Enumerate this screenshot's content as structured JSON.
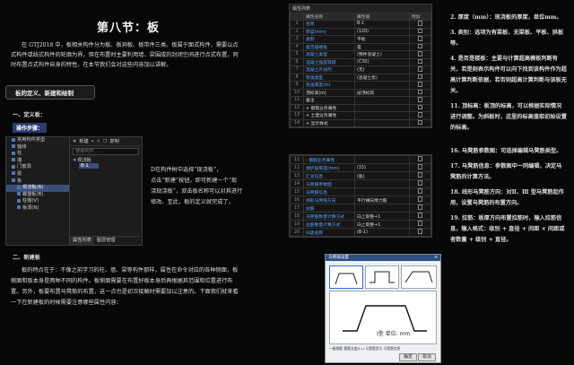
{
  "doc": {
    "title": "第八节：板",
    "intro": "在 GTJ2018 中，板相关构件分为板、板洞板、板带件三类。板属于面式构件，需要以点式构件或线式构件的轮廓为界，但在布置时主要利用墙、梁围成的封闭空间进行点式布置，同时布置点式构件自身的特性。在本节我们会对这些内容加以讲解。",
    "banner": "板的定义、新建和绘制",
    "sec1_heading": "一、定义板：",
    "sec1_step": "操作步骤：",
    "sec1_para_a": "D在构件树中选择“现浇板”，",
    "sec1_para_b": "点击“新建”按钮，即可新建一个“现",
    "sec1_para_c": "浇现浇板”，双击板名称可以对其进行",
    "sec1_para_d": "修改。至此，板的定义就完成了。",
    "sec2_heading": "二、新建板",
    "sec2_para": "板的特点在于：不像之前学习的柱、墙、梁等构件那样，属性在命令对应的各种侧面，板侧面和板本身是两种不同的构件。板侧面需要在布置好板本身后再根据其范围和位置进行布置。另外，板要布置马凳筋的布置，这一点也是初次接触时需要加以注意的。下面我们就来看一下在新建板的时候需要注意哪些属性内容："
  },
  "tree_panel": {
    "items": [
      "常用构件类型",
      "轴线",
      "柱",
      "墙",
      "门窗洞",
      "梁",
      "板",
      "现浇板(B)",
      "螺旋板(B)",
      "柱帽(V)",
      "板洞(N)"
    ],
    "selected_index": 7,
    "toolbar": {
      "new_label": "新建",
      "copy_label": "复制"
    },
    "search_placeholder": "搜索构件...",
    "list_header": "现浇板",
    "list_item": "B-1",
    "tabs": [
      "属性列表",
      "图层管理"
    ]
  },
  "prop_table": {
    "title": "属性列表",
    "headers": [
      "",
      "属性名称",
      "属性值",
      "附加"
    ],
    "rows": [
      {
        "n": "1",
        "name": "名称",
        "value": "B-1",
        "blue": true
      },
      {
        "n": "2",
        "name": "厚度(mm)",
        "value": "(120)",
        "blue": true
      },
      {
        "n": "3",
        "name": "类别",
        "value": "平板",
        "blue": true
      },
      {
        "n": "4",
        "name": "是否是楼板",
        "value": "是",
        "blue": true
      },
      {
        "n": "5",
        "name": "混凝土类型",
        "value": "(预拌混凝土)",
        "blue": true
      },
      {
        "n": "6",
        "name": "混凝土强度等级",
        "value": "(C30)",
        "blue": true
      },
      {
        "n": "7",
        "name": "混凝土外加剂",
        "value": "(无)",
        "blue": true
      },
      {
        "n": "8",
        "name": "泵送类型",
        "value": "(混凝土泵)",
        "blue": true
      },
      {
        "n": "9",
        "name": "泵送高度(m)",
        "value": "",
        "blue": true
      },
      {
        "n": "10",
        "name": "顶标高(m)",
        "value": "层顶标高",
        "blue": false
      },
      {
        "n": "11",
        "name": "备注",
        "value": "",
        "blue": false
      },
      {
        "n": "12",
        "name": "+ 钢筋业务属性",
        "value": "",
        "blue": false
      },
      {
        "n": "13",
        "name": "+ 土建业务属性",
        "value": "",
        "blue": false
      },
      {
        "n": "14",
        "name": "+ 显示样式",
        "value": "",
        "blue": false
      }
    ]
  },
  "prop_table2": {
    "rows": [
      {
        "n": "11",
        "name": "- 钢筋业务属性",
        "value": ""
      },
      {
        "n": "12",
        "name": "保护层厚度(mm)",
        "value": "(15)"
      },
      {
        "n": "13",
        "name": "汇总信息",
        "value": "(板)"
      },
      {
        "n": "14",
        "name": "马凳筋参数图",
        "value": ""
      },
      {
        "n": "15",
        "name": "马凳筋信息",
        "value": ""
      },
      {
        "n": "16",
        "name": "线形马凳筋方向",
        "value": "平行横向受力筋"
      },
      {
        "n": "17",
        "name": "拉筋",
        "value": ""
      },
      {
        "n": "18",
        "name": "马凳筋数量计算方式",
        "value": "向上取整+1"
      },
      {
        "n": "19",
        "name": "拉筋数量计算方式",
        "value": "向上取整+1"
      },
      {
        "n": "20",
        "name": "归类名称",
        "value": "(B-1)"
      }
    ]
  },
  "dialog": {
    "title": "马凳筋设置",
    "shape_label": "I型 单位: mm",
    "footer": "一级钢筋  箍筋长度(L1)  马凳筋型号  马凳筋信息",
    "ok_label": "确定",
    "cancel_label": "取消"
  },
  "right_col": {
    "p1": "2. 厚度（mm）：现浇板的厚度，单位mm。",
    "p2": "3. 类别：选项为有梁板、无梁板、平板、拱板等。",
    "p3": "4. 是否是楼板：主要与计算超高模板判断有关，若是则表示构件可以向下找到该构件作为超高计算判断依据，若否则超高计算判断与该板无关。",
    "p4": "11. 顶标高：板顶的标高，可以根据实际情况进行调整。为斜板时，这里的标高值取初始设置的标高。",
    "p5": "16. 马凳筋参数图：可选择编辑马凳筋类型。",
    "p6": "17. 马凳筋信息：参数图中一同编辑，决定马凳筋的计算方法。",
    "p7": "18. 线形马凳筋方向：对Ⅱ、Ⅲ 型马凳筋起作用，设置马凳筋的布置方向。",
    "p8": "19. 拉筋：板厚方向布置拉筋时，输入拉筋信息，输入格式：级别 + 直径 + 间距 × 间距或者数量 + 级别 + 直径。"
  }
}
